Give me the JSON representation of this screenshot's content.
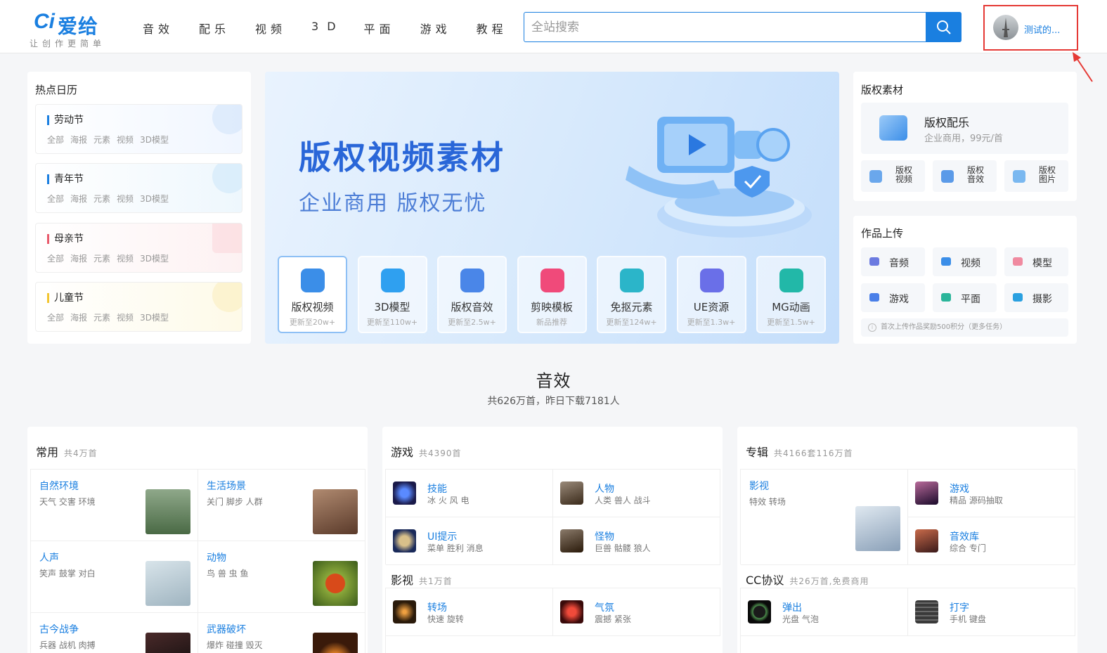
{
  "header": {
    "logo_mark": "Ci",
    "logo_name": "爱给",
    "slogan": "让创作更简单",
    "nav": [
      "音效",
      "配乐",
      "视频",
      "3D",
      "平面",
      "游戏",
      "教程"
    ],
    "search_placeholder": "全站搜索",
    "user_name": "测试的..."
  },
  "calendar": {
    "title": "热点日历",
    "items": [
      {
        "name": "劳动节",
        "color": "#1a7fe0"
      },
      {
        "name": "青年节",
        "color": "#1a7fe0"
      },
      {
        "name": "母亲节",
        "color": "#e8596b"
      },
      {
        "name": "儿童节",
        "color": "#f2c530"
      }
    ],
    "tags": [
      "全部",
      "海报",
      "元素",
      "视频",
      "3D模型"
    ]
  },
  "banner": {
    "title": "版权视频素材",
    "subtitle": "企业商用  版权无忧",
    "tiles": [
      {
        "label": "版权视频",
        "sub": "更新至20w+",
        "color": "#3b8ee8"
      },
      {
        "label": "3D模型",
        "sub": "更新至110w+",
        "color": "#2fa0f0"
      },
      {
        "label": "版权音效",
        "sub": "更新至2.5w+",
        "color": "#4a86e8"
      },
      {
        "label": "剪映模板",
        "sub": "新品推荐",
        "color": "#f04a7a"
      },
      {
        "label": "免抠元素",
        "sub": "更新至124w+",
        "color": "#2bb5c9"
      },
      {
        "label": "UE资源",
        "sub": "更新至1.3w+",
        "color": "#6a6fe8"
      },
      {
        "label": "MG动画",
        "sub": "更新至1.5w+",
        "color": "#22b8a8"
      }
    ]
  },
  "copyright": {
    "title": "版权素材",
    "main_title": "版权配乐",
    "main_sub": "企业商用，99元/首",
    "items": [
      {
        "label": "版权视频",
        "color": "#6aa7ec"
      },
      {
        "label": "版权音效",
        "color": "#5b9ae8"
      },
      {
        "label": "版权图片",
        "color": "#7ab8f0"
      }
    ]
  },
  "upload": {
    "title": "作品上传",
    "items": [
      {
        "label": "音频",
        "color": "#6b7ae0"
      },
      {
        "label": "视频",
        "color": "#3b8ee8"
      },
      {
        "label": "模型",
        "color": "#f08aa0"
      },
      {
        "label": "游戏",
        "color": "#4a7fe8"
      },
      {
        "label": "平面",
        "color": "#2bb59a"
      },
      {
        "label": "摄影",
        "color": "#2aa0e0"
      }
    ],
    "note": "首次上传作品奖励500积分（更多任务）"
  },
  "section": {
    "title": "音效",
    "sub": "共626万首，昨日下载7181人"
  },
  "columns": {
    "common": {
      "title": "常用",
      "count": "共4万首",
      "cells": [
        {
          "name": "自然环境",
          "tags": "天气 交害 环境",
          "thumb": "#5f7a5a"
        },
        {
          "name": "生活场景",
          "tags": "关门 脚步 人群",
          "thumb": "#6a4a3a"
        },
        {
          "name": "人声",
          "tags": "笑声 鼓掌 对白",
          "thumb": "#b8c8d2"
        },
        {
          "name": "动物",
          "tags": "鸟 兽 虫 鱼",
          "thumb": "#6f8a2a"
        },
        {
          "name": "古今战争",
          "tags": "兵器 战机 肉搏",
          "thumb": "#2a1a1a"
        },
        {
          "name": "武器破坏",
          "tags": "爆炸 碰撞 毁灭",
          "thumb": "#3a1a0a"
        }
      ]
    },
    "games": {
      "title": "游戏",
      "count": "共4390首",
      "cells": [
        {
          "name": "技能",
          "tags": "冰 火 风 电",
          "thumb": "#1a2a8a"
        },
        {
          "name": "人物",
          "tags": "人类 兽人 战斗",
          "thumb": "#6a5a4a"
        },
        {
          "name": "UI提示",
          "tags": "菜单 胜利 消息",
          "thumb": "#2a3a6a"
        },
        {
          "name": "怪物",
          "tags": "巨兽 骷髅 狼人",
          "thumb": "#5a4a3a"
        }
      ],
      "film_title": "影视",
      "film_count": "共1万首",
      "film_cells": [
        {
          "name": "转场",
          "tags": "快速 旋转",
          "thumb": "#3a2a0a"
        },
        {
          "name": "气氛",
          "tags": "震撼 紧张",
          "thumb": "#8a1a1a"
        }
      ]
    },
    "albums": {
      "title": "专辑",
      "count": "共4166套116万首",
      "feature_name": "影视",
      "feature_tags": "特效 转场",
      "cells": [
        {
          "name": "游戏",
          "tags": "精品 源码抽取",
          "thumb": "#7a4a6a"
        },
        {
          "name": "音效库",
          "tags": "综合 专门",
          "thumb": "#8a3a2a"
        }
      ],
      "cc_title": "CC协议",
      "cc_count": "共26万首,免费商用",
      "cc_cells": [
        {
          "name": "弹出",
          "tags": "光盘 气泡",
          "thumb": "#1a1a1a"
        },
        {
          "name": "打字",
          "tags": "手机 键盘",
          "thumb": "#2a2a2a"
        }
      ]
    }
  }
}
